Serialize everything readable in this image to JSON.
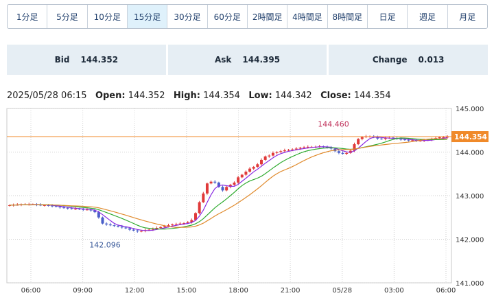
{
  "tabs": [
    {
      "label": "1分足",
      "active": false
    },
    {
      "label": "5分足",
      "active": false
    },
    {
      "label": "10分足",
      "active": false
    },
    {
      "label": "15分足",
      "active": true
    },
    {
      "label": "30分足",
      "active": false
    },
    {
      "label": "60分足",
      "active": false
    },
    {
      "label": "2時間足",
      "active": false
    },
    {
      "label": "4時間足",
      "active": false
    },
    {
      "label": "8時間足",
      "active": false
    },
    {
      "label": "日足",
      "active": false
    },
    {
      "label": "週足",
      "active": false
    },
    {
      "label": "月足",
      "active": false
    }
  ],
  "quotes": {
    "bid_label": "Bid",
    "bid": "144.352",
    "ask_label": "Ask",
    "ask": "144.395",
    "change_label": "Change",
    "change": "0.013"
  },
  "ohlc": {
    "datetime": "2025/05/28 06:15",
    "open_label": "Open:",
    "open": "144.352",
    "high_label": "High:",
    "high": "144.354",
    "low_label": "Low:",
    "low": "144.342",
    "close_label": "Close:",
    "close": "144.354"
  },
  "colors": {
    "up": "#e03a3a",
    "down": "#4a5fc9",
    "ma_short": "#8a2be2",
    "ma_mid": "#2eaa2e",
    "ma_long": "#e08a2c",
    "current_line": "#f08a2a"
  },
  "chart_data": {
    "type": "candlestick",
    "ylim": [
      141.0,
      145.0
    ],
    "y_ticks": [
      "145.000",
      "144.000",
      "143.000",
      "142.000",
      "141.000"
    ],
    "x_ticks": [
      "06:00",
      "09:00",
      "12:00",
      "15:00",
      "18:00",
      "21:00",
      "05/28",
      "03:00",
      "06:00"
    ],
    "current_price": "144.354",
    "annotations": [
      {
        "text": "142.096",
        "value": 142.096
      },
      {
        "text": "144.460",
        "value": 144.46
      }
    ],
    "closes": [
      142.78,
      142.79,
      142.79,
      142.8,
      142.8,
      142.8,
      142.8,
      142.79,
      142.78,
      142.78,
      142.77,
      142.76,
      142.75,
      142.73,
      142.72,
      142.71,
      142.7,
      142.7,
      142.69,
      142.68,
      142.68,
      142.66,
      142.62,
      142.5,
      142.36,
      142.34,
      142.32,
      142.31,
      142.29,
      142.27,
      142.25,
      142.22,
      142.2,
      142.18,
      142.19,
      142.21,
      142.22,
      142.24,
      142.26,
      142.28,
      142.3,
      142.32,
      142.34,
      142.35,
      142.36,
      142.37,
      142.39,
      142.44,
      142.6,
      142.85,
      143.05,
      143.28,
      143.32,
      143.3,
      143.2,
      143.12,
      143.2,
      143.25,
      143.3,
      143.42,
      143.48,
      143.55,
      143.62,
      143.66,
      143.72,
      143.82,
      143.9,
      143.92,
      143.98,
      144.0,
      144.02,
      144.04,
      144.05,
      144.06,
      144.08,
      144.1,
      144.11,
      144.12,
      144.12,
      144.12,
      144.13,
      144.12,
      144.1,
      144.08,
      144.02,
      143.98,
      143.96,
      143.98,
      144.03,
      144.18,
      144.3,
      144.34,
      144.36,
      144.36,
      144.34,
      144.31,
      144.3,
      144.32,
      144.33,
      144.32,
      144.3,
      144.29,
      144.28,
      144.27,
      144.27,
      144.26,
      144.26,
      144.27,
      144.28,
      144.3,
      144.32,
      144.34,
      144.34,
      144.35
    ]
  }
}
